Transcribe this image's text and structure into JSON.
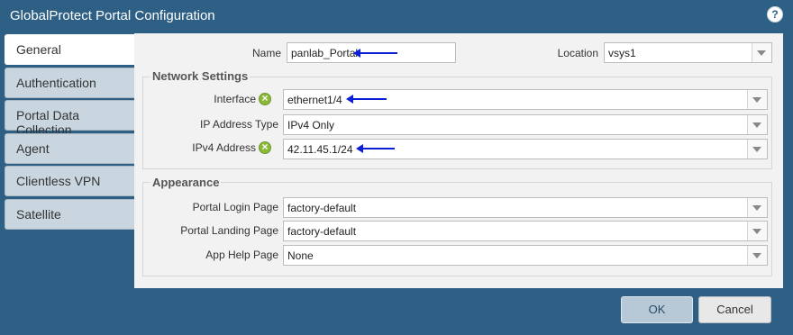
{
  "window": {
    "title": "GlobalProtect Portal Configuration",
    "help_icon": "question-circle-icon",
    "help_glyph": "?"
  },
  "tabs": [
    {
      "label": "General",
      "active": true
    },
    {
      "label": "Authentication",
      "active": false
    },
    {
      "label": "Portal Data Collection",
      "active": false
    },
    {
      "label": "Agent",
      "active": false
    },
    {
      "label": "Clientless VPN",
      "active": false
    },
    {
      "label": "Satellite",
      "active": false
    }
  ],
  "general": {
    "name_label": "Name",
    "name_value": "panlab_Portal",
    "location_label": "Location",
    "location_value": "vsys1"
  },
  "network_settings": {
    "legend": "Network Settings",
    "interface_label": "Interface",
    "interface_value": "ethernet1/4",
    "ip_type_label": "IP Address Type",
    "ip_type_value": "IPv4 Only",
    "ipv4_label": "IPv4 Address",
    "ipv4_value": "42.11.45.1/24"
  },
  "appearance": {
    "legend": "Appearance",
    "login_label": "Portal Login Page",
    "login_value": "factory-default",
    "landing_label": "Portal Landing Page",
    "landing_value": "factory-default",
    "apphelp_label": "App Help Page",
    "apphelp_value": "None"
  },
  "footer": {
    "ok_label": "OK",
    "cancel_label": "Cancel"
  },
  "colors": {
    "title_bar": "#2e6086",
    "annotation_arrow": "#0a1fd6",
    "status_green": "#8ab838"
  }
}
